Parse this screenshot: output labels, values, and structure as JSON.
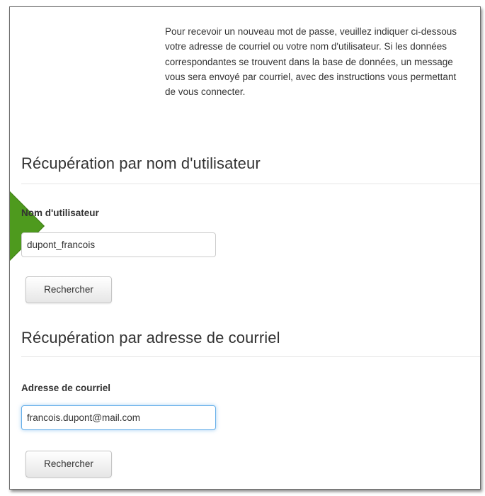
{
  "intro_text": "Pour recevoir un nouveau mot de passe, veuillez indiquer ci-dessous votre adresse de courriel ou votre nom d'utilisateur. Si les données correspondantes se trouvent dans la base de données, un message vous sera envoyé par courriel, avec des instructions vous permettant de vous connecter.",
  "username_section": {
    "title": "Récupération par nom d'utilisateur",
    "field_label": "Nom d'utilisateur",
    "field_value": "dupont_francois",
    "button_label": "Rechercher"
  },
  "email_section": {
    "title": "Récupération par adresse de courriel",
    "field_label": "Adresse de courriel",
    "field_value": "francois.dupont@mail.com",
    "button_label": "Rechercher"
  },
  "colors": {
    "arrow": "#4e9a1e",
    "focus_border": "#66afe9"
  },
  "icons": {
    "arrow": "green-pointer-arrow"
  }
}
